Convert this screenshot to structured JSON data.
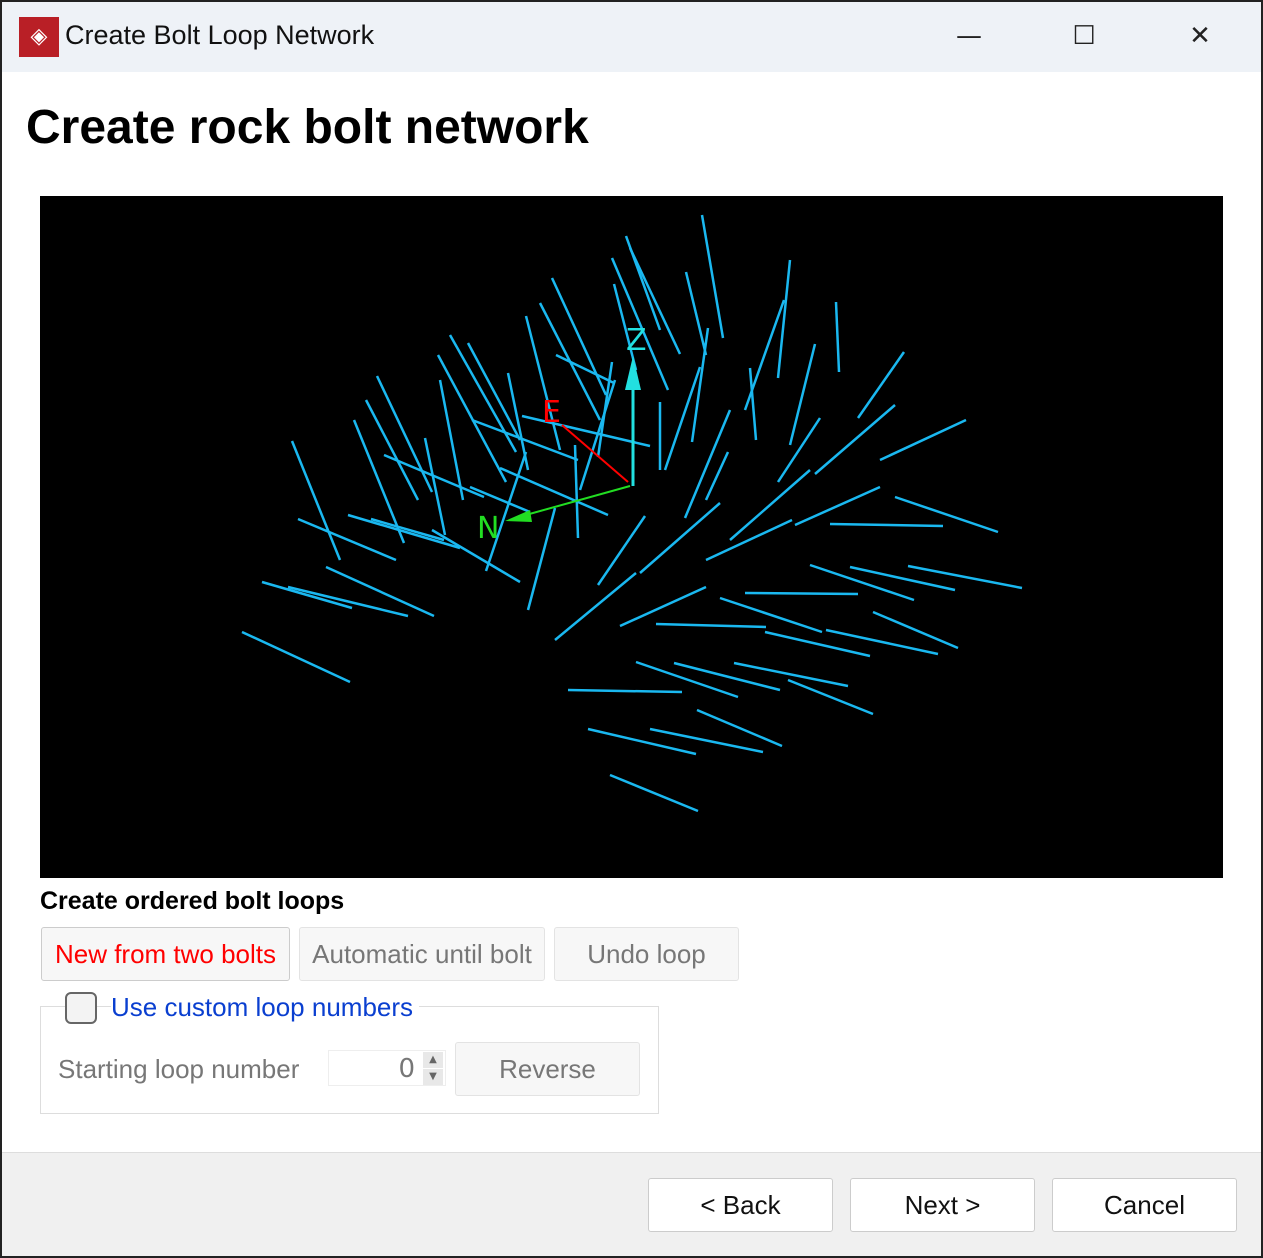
{
  "window": {
    "title": "Create Bolt Loop Network",
    "minimize": "—",
    "maximize": "☐",
    "close": "✕"
  },
  "page_title": "Create rock bolt network",
  "viewport": {
    "axis_labels": {
      "z": "Z",
      "e": "E",
      "n": "N"
    },
    "colors": {
      "bolt": "#1ab8f0",
      "z": "#22e0e0",
      "e": "#ff0000",
      "n": "#22dd22"
    }
  },
  "loops": {
    "heading": "Create ordered bolt loops",
    "new_from_two": "New from two bolts",
    "automatic": "Automatic until bolt",
    "undo": "Undo loop"
  },
  "custom": {
    "checkbox_label": "Use custom loop numbers",
    "checked": false,
    "starting_label": "Starting loop number",
    "starting_value": "0",
    "reverse": "Reverse"
  },
  "footer": {
    "back": "< Back",
    "next": "Next >",
    "cancel": "Cancel"
  }
}
